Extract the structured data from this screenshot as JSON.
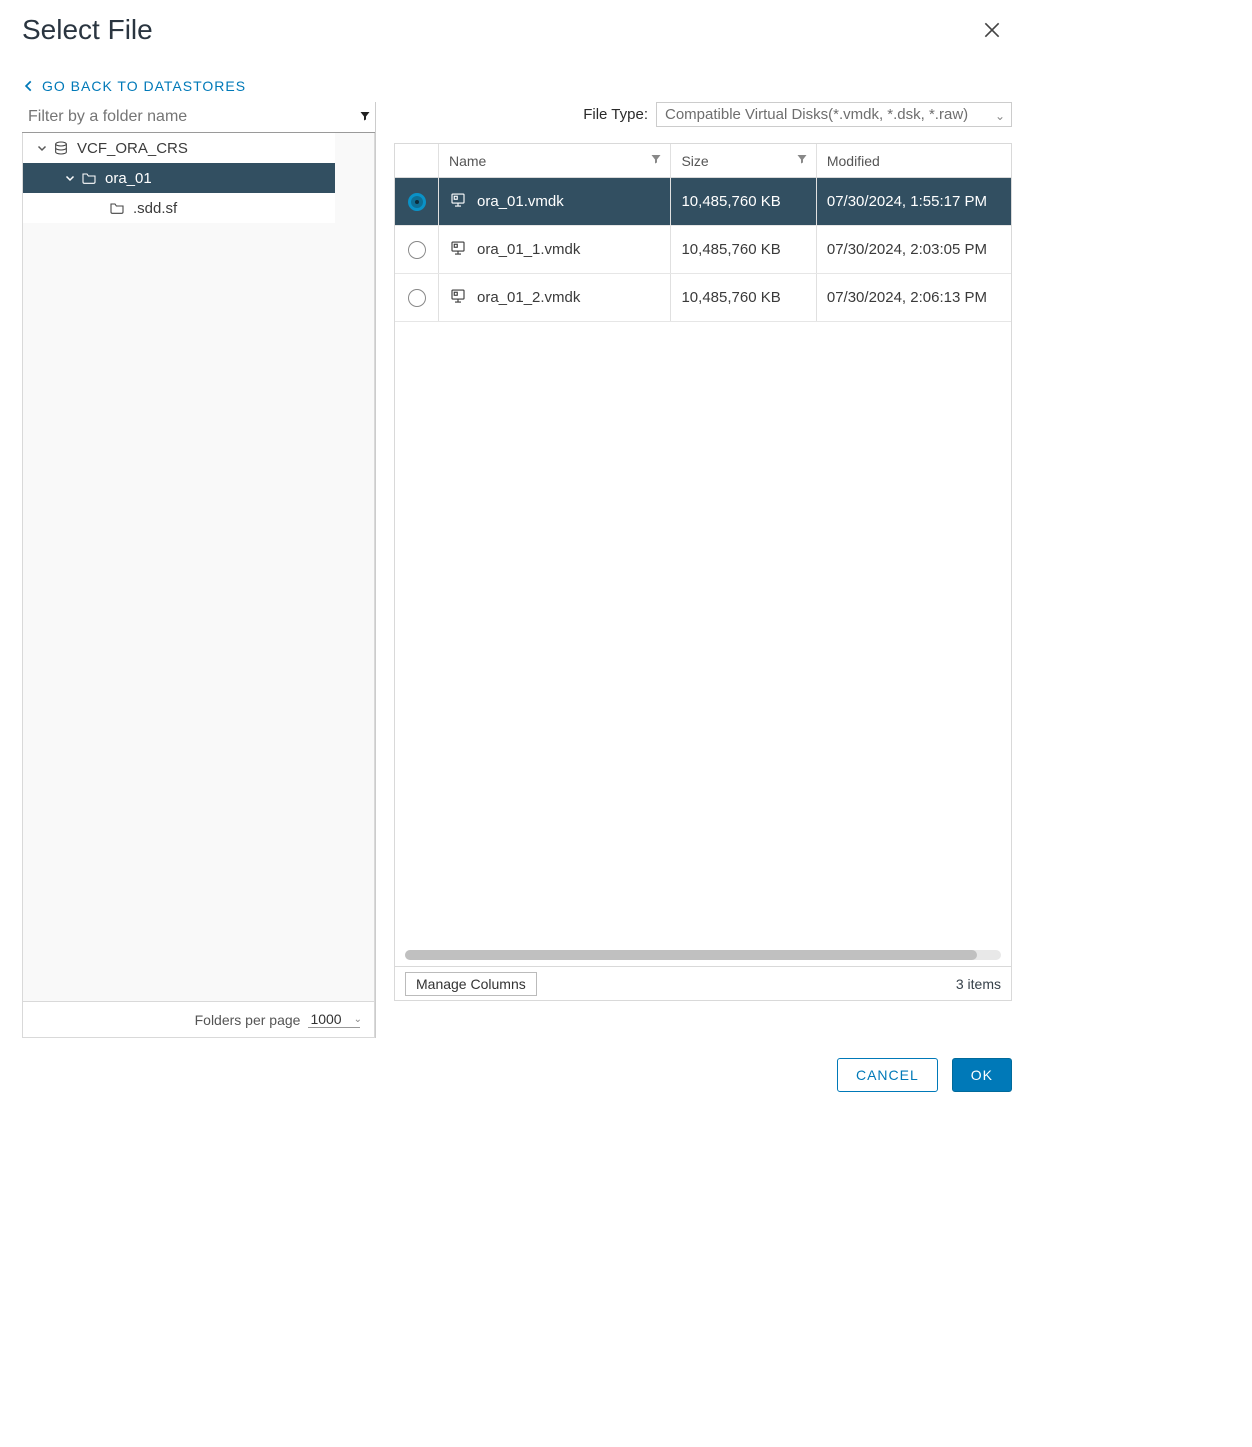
{
  "dialog": {
    "title": "Select File",
    "back_link": "GO BACK TO DATASTORES"
  },
  "filter": {
    "placeholder": "Filter by a folder name"
  },
  "tree": {
    "root": {
      "label": "VCF_ORA_CRS"
    },
    "child": {
      "label": "ora_01"
    },
    "leaf": {
      "label": ".sdd.sf"
    }
  },
  "folders_per_page": {
    "label": "Folders per page",
    "value": "1000"
  },
  "file_type": {
    "label": "File Type:",
    "value": "Compatible Virtual Disks(*.vmdk, *.dsk, *.raw)"
  },
  "grid": {
    "columns": {
      "name": "Name",
      "size": "Size",
      "modified": "Modified"
    },
    "rows": [
      {
        "name": "ora_01.vmdk",
        "size": "10,485,760 KB",
        "modified": "07/30/2024, 1:55:17 PM",
        "selected": true
      },
      {
        "name": "ora_01_1.vmdk",
        "size": "10,485,760 KB",
        "modified": "07/30/2024, 2:03:05 PM",
        "selected": false
      },
      {
        "name": "ora_01_2.vmdk",
        "size": "10,485,760 KB",
        "modified": "07/30/2024, 2:06:13 PM",
        "selected": false
      }
    ],
    "manage_columns": "Manage Columns",
    "item_count": "3 items"
  },
  "buttons": {
    "cancel": "CANCEL",
    "ok": "OK"
  }
}
